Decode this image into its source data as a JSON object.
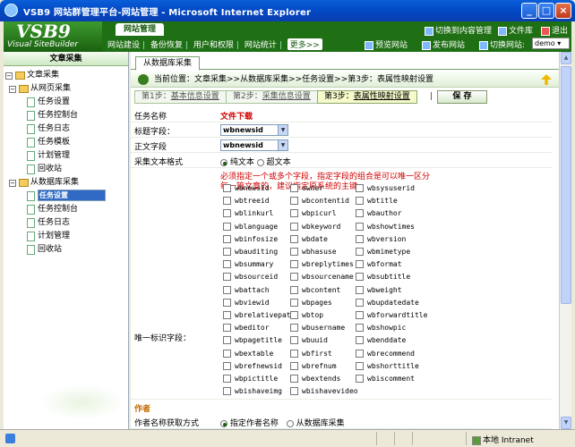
{
  "window": {
    "title": "VSB9 网站群管理平台-网站管理 - Microsoft Internet Explorer"
  },
  "header": {
    "logo_big": "VSB9",
    "logo_small": "Visual SiteBuilder",
    "main_tab": "网站管理",
    "nav": [
      "网站建设",
      "备份恢复",
      "用户和权限",
      "网站统计"
    ],
    "more": "更多>>",
    "switch_content": "切换到内容管理",
    "file_lib": "文件库",
    "logout": "退出",
    "preview": "预览网站",
    "publish": "发布网站",
    "switch_site": "切换网站:",
    "site_value": "demo"
  },
  "sidebar": {
    "header": "文章采集",
    "tree": [
      {
        "label": "文章采集",
        "level": 0,
        "type": "root"
      },
      {
        "label": "从网页采集",
        "level": 1,
        "type": "folder"
      },
      {
        "label": "任务设置",
        "level": 2,
        "type": "page"
      },
      {
        "label": "任务控制台",
        "level": 2,
        "type": "page"
      },
      {
        "label": "任务日志",
        "level": 2,
        "type": "page"
      },
      {
        "label": "任务模板",
        "level": 2,
        "type": "page"
      },
      {
        "label": "计划管理",
        "level": 2,
        "type": "page"
      },
      {
        "label": "回收站",
        "level": 2,
        "type": "page"
      },
      {
        "label": "从数据库采集",
        "level": 1,
        "type": "folder"
      },
      {
        "label": "任务设置",
        "level": 2,
        "type": "page",
        "selected": true
      },
      {
        "label": "任务控制台",
        "level": 2,
        "type": "page"
      },
      {
        "label": "任务日志",
        "level": 2,
        "type": "page"
      },
      {
        "label": "计划管理",
        "level": 2,
        "type": "page"
      },
      {
        "label": "回收站",
        "level": 2,
        "type": "page"
      }
    ]
  },
  "main": {
    "tab": "从数据库采集",
    "breadcrumb": "当前位置：文章采集>>从数据库采集>>任务设置>>第3步：表属性映射设置",
    "steps": [
      {
        "prefix": "第1步：",
        "label": "基本信息设置"
      },
      {
        "prefix": "第2步：",
        "label": "采集信息设置"
      },
      {
        "prefix": "第3步：",
        "label": "表属性映射设置",
        "active": true
      }
    ],
    "step_sep": "|",
    "save": "保 存",
    "task_name_label": "任务名称",
    "task_name_value": "文件下载",
    "title_field_label": "标题字段：",
    "title_field_value": "wbnewsid",
    "body_field_label": "正文字段",
    "body_field_value": "wbnewsid",
    "format_label": "采集文本格式",
    "format_plain": "纯文本",
    "format_hyper": "超文本",
    "hint_line1": "必须指定一个或多个字段，指定字段的组合是可以唯一区分",
    "hint_line2": "每一篇文章的，建议指定原系统的主键",
    "unique_label": "唯一标识字段：",
    "fields": [
      [
        "wbnewsid",
        "owner",
        "wbsysuserid"
      ],
      [
        "wbtreeid",
        "wbcontentid",
        "wbtitle"
      ],
      [
        "wblinkurl",
        "wbpicurl",
        "wbauthor"
      ],
      [
        "wblanguage",
        "wbkeyword",
        "wbshowtimes"
      ],
      [
        "wbinfosize",
        "wbdate",
        "wbversion"
      ],
      [
        "wbauditing",
        "wbhasuse",
        "wbmimetype"
      ],
      [
        "wbsummary",
        "wbreplytimes",
        "wbformat"
      ],
      [
        "wbsourceid",
        "wbsourcename",
        "wbsubtitle"
      ],
      [
        "wbattach",
        "wbcontent",
        "wbweight"
      ],
      [
        "wbviewid",
        "wbpages",
        "wbupdatedate"
      ],
      [
        "wbrelativepath",
        "wbtop",
        "wbforwardtitle"
      ],
      [
        "wbeditor",
        "wbusername",
        "wbshowpic"
      ],
      [
        "wbpagetitle",
        "wbuuid",
        "wbenddate"
      ],
      [
        "wbextable",
        "wbfirst",
        "wbrecommend"
      ],
      [
        "wbrefnewsid",
        "wbrefnum",
        "wbshorttitle"
      ],
      [
        "wbpictitle",
        "wbextends",
        "wbiscomment"
      ],
      [
        "wbishaveimg",
        "wbishavevideo",
        ""
      ]
    ],
    "author_section": "作者",
    "author_method_label": "作者名称获取方式",
    "author_opt1": "指定作者名称",
    "author_opt2": "从数据库采集"
  },
  "status": {
    "zone": "本地 Intranet"
  }
}
